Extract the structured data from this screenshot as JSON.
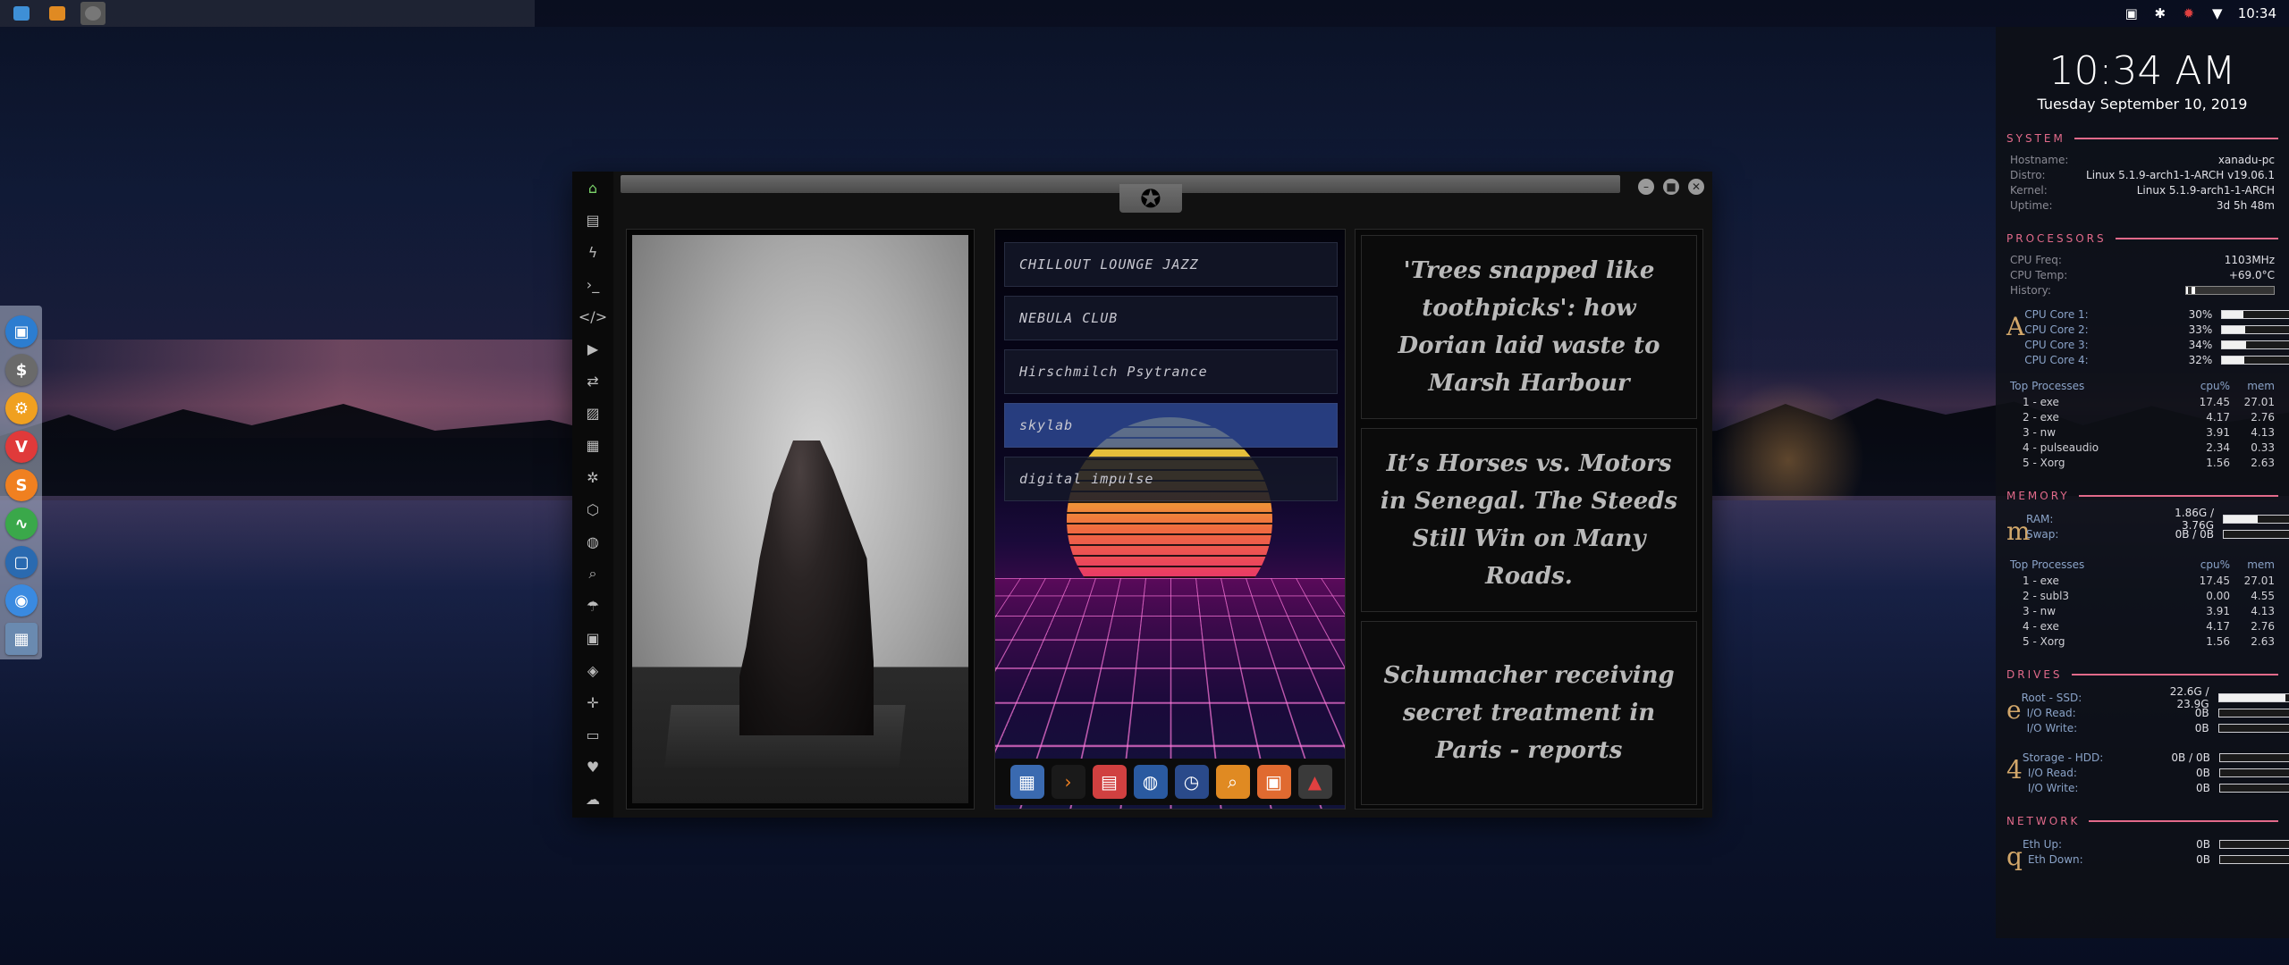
{
  "tray": {
    "time": "10:34"
  },
  "window": {
    "stations": [
      {
        "label": "CHILLOUT LOUNGE JAZZ"
      },
      {
        "label": "NEBULA CLUB"
      },
      {
        "label": "Hirschmilch Psytrance"
      },
      {
        "label": "skylab"
      },
      {
        "label": "digital impulse"
      }
    ],
    "news": [
      {
        "headline": "'Trees snapped like toothpicks': how Dorian laid waste to Marsh Harbour"
      },
      {
        "headline": "It’s Horses vs. Motors in Senegal. The Steeds Still Win on Many Roads."
      },
      {
        "headline": "Schumacher receiving secret treatment in Paris - reports"
      }
    ]
  },
  "conky": {
    "time": "10:34 AM",
    "date": "Tuesday September 10, 2019",
    "system": {
      "title": "SYSTEM",
      "hostname_k": "Hostname:",
      "hostname_v": "xanadu-pc",
      "distro_k": "Distro:",
      "distro_v": "Linux 5.1.9-arch1-1-ARCH v19.06.1",
      "kernel_k": "Kernel:",
      "kernel_v": "Linux 5.1.9-arch1-1-ARCH",
      "uptime_k": "Uptime:",
      "uptime_v": "3d 5h 48m"
    },
    "processors": {
      "title": "PROCESSORS",
      "freq_k": "CPU Freq:",
      "freq_v": "1103MHz",
      "temp_k": "CPU Temp:",
      "temp_v": "+69.0°C",
      "history_k": "History:",
      "letter": "A",
      "cores": [
        {
          "label": "CPU Core 1:",
          "value": "30%",
          "level": 0.3
        },
        {
          "label": "CPU Core 2:",
          "value": "33%",
          "level": 0.33
        },
        {
          "label": "CPU Core 3:",
          "value": "34%",
          "level": 0.34
        },
        {
          "label": "CPU Core 4:",
          "value": "32%",
          "level": 0.32
        }
      ],
      "top_h": "Top Processes",
      "cpu_h": "cpu%",
      "mem_h": "mem",
      "top": [
        {
          "name": "1 - exe",
          "cpu": "17.45",
          "mem": "27.01"
        },
        {
          "name": "2 - exe",
          "cpu": "4.17",
          "mem": "2.76"
        },
        {
          "name": "3 - nw",
          "cpu": "3.91",
          "mem": "4.13"
        },
        {
          "name": "4 - pulseaudio",
          "cpu": "2.34",
          "mem": "0.33"
        },
        {
          "name": "5 - Xorg",
          "cpu": "1.56",
          "mem": "2.63"
        }
      ]
    },
    "memory": {
      "title": "MEMORY",
      "letter": "m",
      "ram_k": "RAM:",
      "ram_v": "1.86G / 3.76G",
      "ram_level": 0.49,
      "swap_k": "Swap:",
      "swap_v": "0B / 0B",
      "swap_level": 0,
      "top_h": "Top Processes",
      "cpu_h": "cpu%",
      "mem_h": "mem",
      "top": [
        {
          "name": "1 - exe",
          "cpu": "17.45",
          "mem": "27.01"
        },
        {
          "name": "2 - subl3",
          "cpu": "0.00",
          "mem": "4.55"
        },
        {
          "name": "3 - nw",
          "cpu": "3.91",
          "mem": "4.13"
        },
        {
          "name": "4 - exe",
          "cpu": "4.17",
          "mem": "2.76"
        },
        {
          "name": "5 - Xorg",
          "cpu": "1.56",
          "mem": "2.63"
        }
      ]
    },
    "drives": {
      "title": "DRIVES",
      "root": {
        "letter": "e",
        "label": "Root - SSD:",
        "value": "22.6G / 23.9G",
        "level": 0.95,
        "read_k": "I/O Read:",
        "read_v": "0B",
        "write_k": "I/O Write:",
        "write_v": "0B"
      },
      "storage": {
        "letter": "4",
        "label": "Storage - HDD:",
        "value": "0B / 0B",
        "level": 0,
        "read_k": "I/O Read:",
        "read_v": "0B",
        "write_k": "I/O Write:",
        "write_v": "0B"
      }
    },
    "network": {
      "title": "NETWORK",
      "letter": "q",
      "up_k": "Eth Up:",
      "up_v": "0B",
      "down_k": "Eth Down:",
      "down_v": "0B"
    }
  }
}
